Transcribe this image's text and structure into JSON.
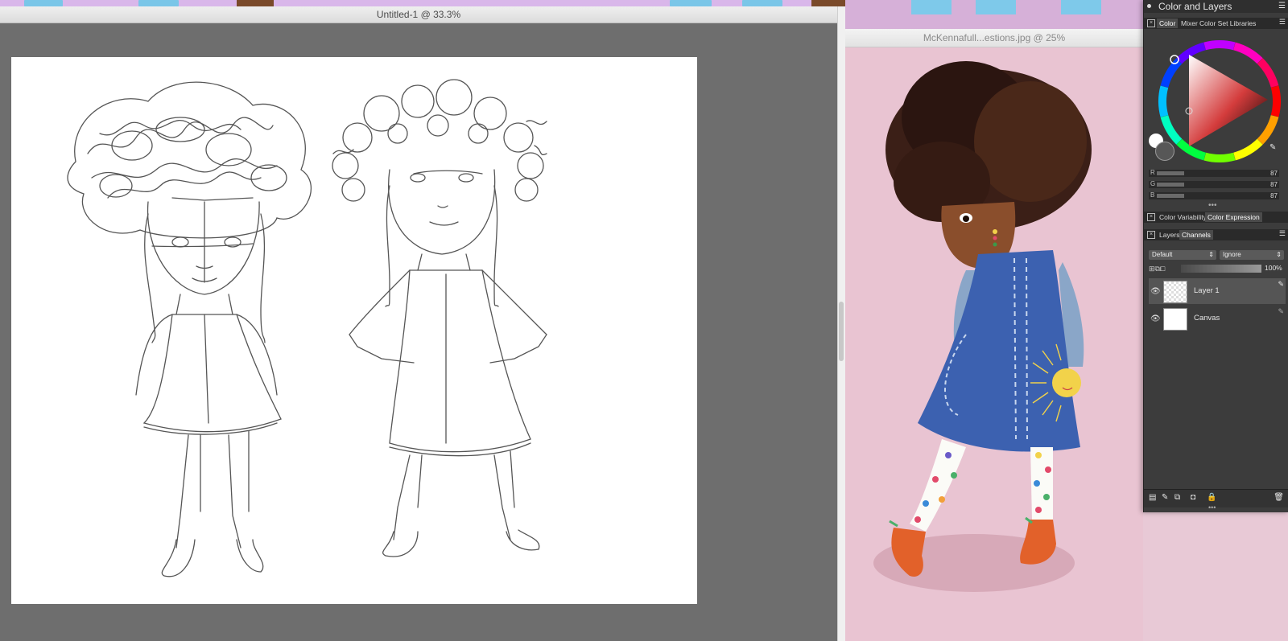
{
  "left_window": {
    "title": "Untitled-1 @ 33.3%"
  },
  "right_window": {
    "title": "McKennafull...estions.jpg @ 25%"
  },
  "panel": {
    "title": "Color and Layers",
    "color_tabs": [
      "Color",
      "Mixer",
      "Color Set Libraries"
    ],
    "rgb": [
      {
        "label": "R",
        "value": "87"
      },
      {
        "label": "G",
        "value": "87"
      },
      {
        "label": "B",
        "value": "87"
      }
    ],
    "variability_tabs": [
      "Color Variability",
      "Color Expression"
    ],
    "layer_tabs": [
      "Layers",
      "Channels"
    ],
    "composite_method": "Default",
    "composite_mode": "Ignore",
    "opacity": "100%",
    "layers": [
      {
        "name": "Layer 1",
        "selected": true
      },
      {
        "name": "Canvas",
        "selected": false
      }
    ]
  },
  "colors": {
    "panel_bg": "#3c3c3c",
    "canvas_bg": "#6e6e6e",
    "right_bg": "#e9c4d2",
    "dress": "#3c61b0",
    "boots": "#e2612a"
  }
}
